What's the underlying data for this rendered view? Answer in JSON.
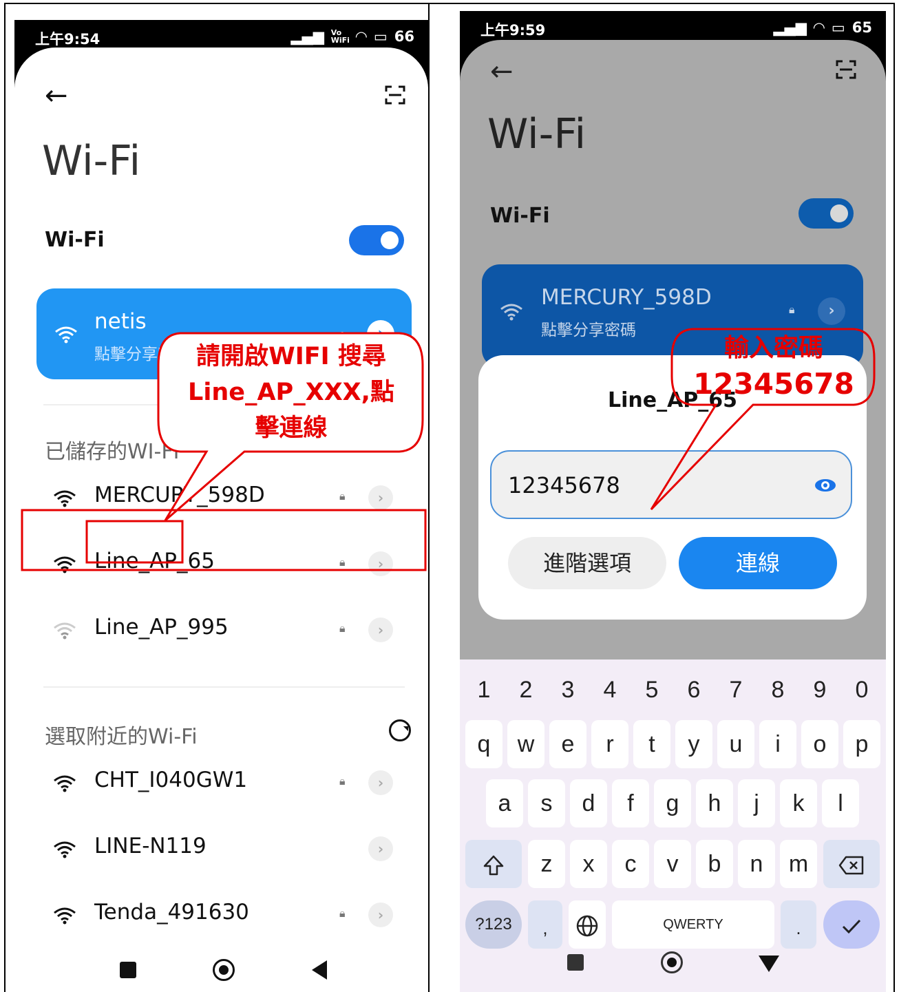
{
  "left": {
    "status": {
      "time": "上午9:54",
      "icons": "Vo WiFi",
      "battery": "66"
    },
    "back_icon": "←",
    "title": "Wi-Fi",
    "wifi_toggle_label": "Wi-Fi",
    "connected": {
      "ssid": "netis",
      "sub": "點擊分享密碼"
    },
    "saved_label": "已儲存的WI-FI",
    "saved": [
      {
        "name": "MERCURY_598D"
      },
      {
        "name": "Line_AP_65"
      },
      {
        "name": "Line_AP_995"
      }
    ],
    "nearby_label": "選取附近的Wi-Fi",
    "nearby": [
      {
        "name": "CHT_I040GW1"
      },
      {
        "name": "LINE-N119"
      },
      {
        "name": "Tenda_491630"
      }
    ],
    "callout": {
      "line1": "請開啟WIFI 搜尋",
      "line2": "Line_AP_XXX,點",
      "line3": "擊連線"
    }
  },
  "right": {
    "status": {
      "time": "上午9:59",
      "battery": "65"
    },
    "back_icon": "←",
    "title": "Wi-Fi",
    "wifi_toggle_label": "Wi-Fi",
    "connected": {
      "ssid": "MERCURY_598D",
      "sub": "點擊分享密碼"
    },
    "dialog": {
      "title": "Line_AP_65",
      "password": "12345678",
      "advanced_label": "進階選項",
      "connect_label": "連線"
    },
    "callout": {
      "line1": "輸入密碼",
      "line2": "12345678"
    },
    "keyboard": {
      "numbers": [
        "1",
        "2",
        "3",
        "4",
        "5",
        "6",
        "7",
        "8",
        "9",
        "0"
      ],
      "row1": [
        "q",
        "w",
        "e",
        "r",
        "t",
        "y",
        "u",
        "i",
        "o",
        "p"
      ],
      "row2": [
        "a",
        "s",
        "d",
        "f",
        "g",
        "h",
        "j",
        "k",
        "l"
      ],
      "row3": [
        "z",
        "x",
        "c",
        "v",
        "b",
        "n",
        "m"
      ],
      "symbols_label": "?123",
      "comma": ",",
      "space_label": "QWERTY",
      "period": "."
    }
  },
  "colors": {
    "accent": "#1a73e8",
    "annotation": "#e60000"
  }
}
